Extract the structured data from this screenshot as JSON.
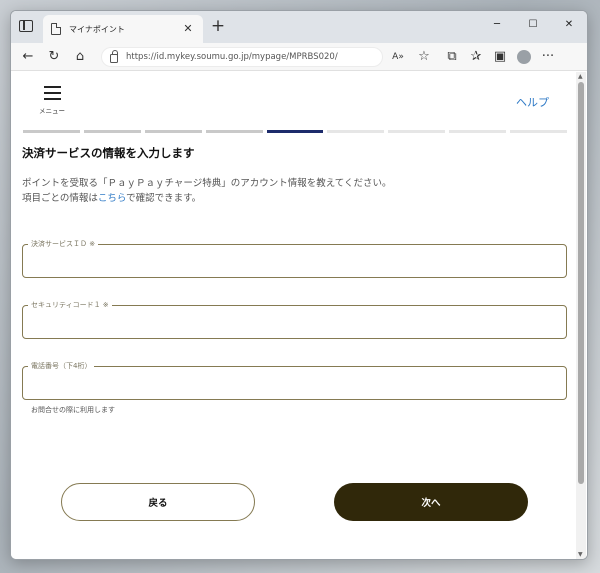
{
  "browser": {
    "tab_title": "マイナポイント",
    "tab_close": "✕",
    "new_tab": "+",
    "url": "https://id.mykey.soumu.go.jp/mypage/MPRBS020/",
    "window_controls": {
      "minimize": "─",
      "maximize": "☐",
      "close": "✕"
    },
    "nav": {
      "back": "←",
      "refresh": "↻",
      "home": "⌂"
    },
    "toolbar_icons": {
      "read_aloud": "A», ",
      "favorite_add": "☆",
      "extensions": "⧉",
      "favorites": "✰",
      "collections": "▣",
      "more": "···"
    }
  },
  "header": {
    "menu_label": "メニュー",
    "help_label": "ヘルプ"
  },
  "progress": {
    "total_steps": 9,
    "current_step": 5
  },
  "main": {
    "heading": "決済サービスの情報を入力します",
    "description_line1": "ポイントを受取る「ＰａｙＰａｙチャージ特典」のアカウント情報を教えてください。",
    "description_line2_prefix": "項目ごとの情報は",
    "description_link": "こちら",
    "description_line2_suffix": "で確認できます。",
    "fields": [
      {
        "label": "決済サービスＩＤ ※",
        "value": ""
      },
      {
        "label": "セキュリティコード１ ※",
        "value": ""
      },
      {
        "label": "電話番号（下4桁）",
        "value": ""
      }
    ],
    "phone_hint": "お問合せの際に利用します",
    "back_label": "戻る",
    "next_label": "次へ"
  }
}
